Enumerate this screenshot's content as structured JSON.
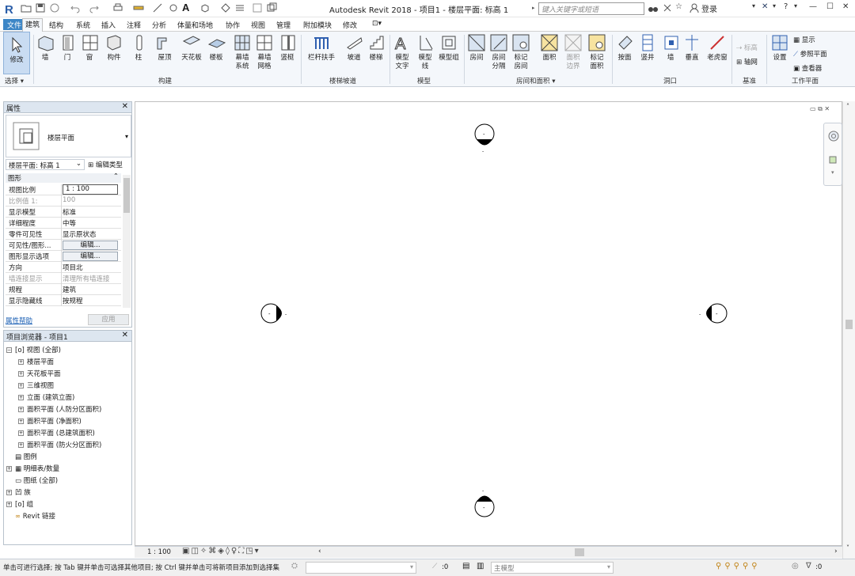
{
  "app": {
    "title": "Autodesk Revit 2018 -    项目1 - 楼层平面: 标高 1",
    "search_placeholder": "键入关键字或短语",
    "login_label": "登录"
  },
  "tabs": [
    "文件",
    "建筑",
    "结构",
    "系统",
    "插入",
    "注释",
    "分析",
    "体量和场地",
    "协作",
    "视图",
    "管理",
    "附加模块",
    "修改"
  ],
  "ribbon": {
    "modify": "修改",
    "select": "选择",
    "build_items": [
      "墙",
      "门",
      "窗",
      "构件",
      "柱",
      "屋顶",
      "天花板",
      "楼板",
      "幕墙系统",
      "幕墙网格",
      "竖梃"
    ],
    "build_panel": "构建",
    "circulation_items": [
      "栏杆扶手",
      "坡道",
      "楼梯"
    ],
    "circulation_panel": "楼梯坡道",
    "model_items": [
      "模型文字",
      "模型线",
      "模型组"
    ],
    "model_panel": "模型",
    "room_items": [
      "房间",
      "房间分隔",
      "标记房间",
      "面积",
      "面积边界",
      "标记面积"
    ],
    "room_panel": "房间和面积",
    "opening_items": [
      "按面",
      "竖井",
      "墙",
      "垂直",
      "老虎窗"
    ],
    "opening_panel": "洞口",
    "datum_items": [
      "标高",
      "轴网"
    ],
    "datum_panel": "基准",
    "workplane_items": [
      "设置",
      "显示",
      "参照平面",
      "查看器"
    ],
    "workplane_panel": "工作平面"
  },
  "properties": {
    "title": "属性",
    "type_name": "楼层平面",
    "instance_selector": "楼层平面: 标高 1",
    "edit_type": "编辑类型",
    "category": "图形",
    "rows": [
      {
        "k": "视图比例",
        "v": "1 : 100"
      },
      {
        "k": "比例值 1:",
        "v": "100"
      },
      {
        "k": "显示模型",
        "v": "标准"
      },
      {
        "k": "详细程度",
        "v": "中等"
      },
      {
        "k": "零件可见性",
        "v": "显示原状态"
      },
      {
        "k": "可见性/图形...",
        "v": "编辑..."
      },
      {
        "k": "图形显示选项",
        "v": "编辑..."
      },
      {
        "k": "方向",
        "v": "项目北"
      },
      {
        "k": "墙连接显示",
        "v": "清理所有墙连接"
      },
      {
        "k": "规程",
        "v": "建筑"
      },
      {
        "k": "显示隐藏线",
        "v": "按规程"
      }
    ],
    "help_link": "属性帮助",
    "apply_label": "应用"
  },
  "browser": {
    "title": "项目浏览器 - 项目1",
    "root": "视图 (全部)",
    "view_items": [
      "楼层平面",
      "天花板平面",
      "三维视图",
      "立面 (建筑立面)",
      "面积平面 (人防分区面积)",
      "面积平面 (净面积)",
      "面积平面 (总建筑面积)",
      "面积平面 (防火分区面积)"
    ],
    "top_items": [
      "图例",
      "明细表/数量",
      "图纸 (全部)",
      "族",
      "组",
      "Revit 链接"
    ]
  },
  "viewbar": {
    "scale": "1 : 100"
  },
  "status": {
    "message": "单击可进行选择; 按 Tab 键并单击可选择其他项目; 按 Ctrl 键并单击可将新项目添加到选择集",
    "worksets_value": ":0",
    "model_label": "主模型",
    "filter_value": ":0"
  },
  "colors": {
    "accent": "#3d86c6",
    "ribbon_bg": "#f4f7fb",
    "panel_header": "#dde6f0"
  }
}
